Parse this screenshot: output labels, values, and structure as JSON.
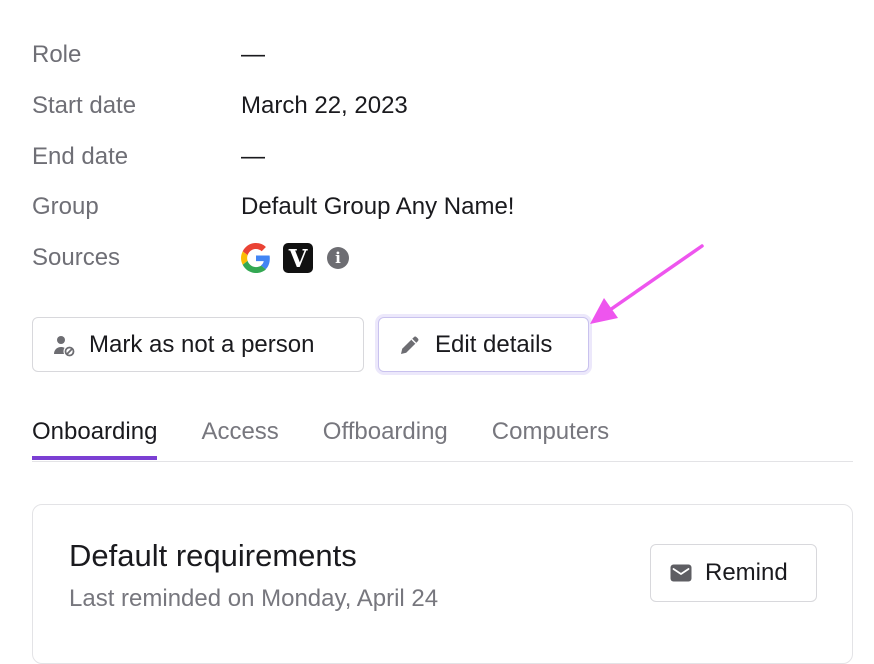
{
  "details": [
    {
      "label": "Role",
      "value": "—"
    },
    {
      "label": "Start date",
      "value": "March 22, 2023"
    },
    {
      "label": "End date",
      "value": "—"
    },
    {
      "label": "Group",
      "value": "Default Group Any Name!"
    },
    {
      "label": "Sources",
      "value": ""
    }
  ],
  "sources": {
    "icons": [
      "google-icon",
      "v-app-icon",
      "info-icon"
    ],
    "v_letter": "V",
    "info_letter": "i"
  },
  "actions": {
    "mark_label": "Mark as not a person",
    "mark_icon": "person-off-icon",
    "edit_label": "Edit details",
    "edit_icon": "pencil-icon"
  },
  "tabs": [
    {
      "label": "Onboarding",
      "active": true
    },
    {
      "label": "Access",
      "active": false
    },
    {
      "label": "Offboarding",
      "active": false
    },
    {
      "label": "Computers",
      "active": false
    }
  ],
  "card": {
    "title": "Default requirements",
    "subtitle": "Last reminded on Monday, April 24",
    "remind_label": "Remind",
    "remind_icon": "mail-icon"
  },
  "colors": {
    "active_tab_underline": "#7b3fd3",
    "annotation_arrow": "#ee55ee",
    "edit_button_focus_ring": "#ece8fb"
  }
}
